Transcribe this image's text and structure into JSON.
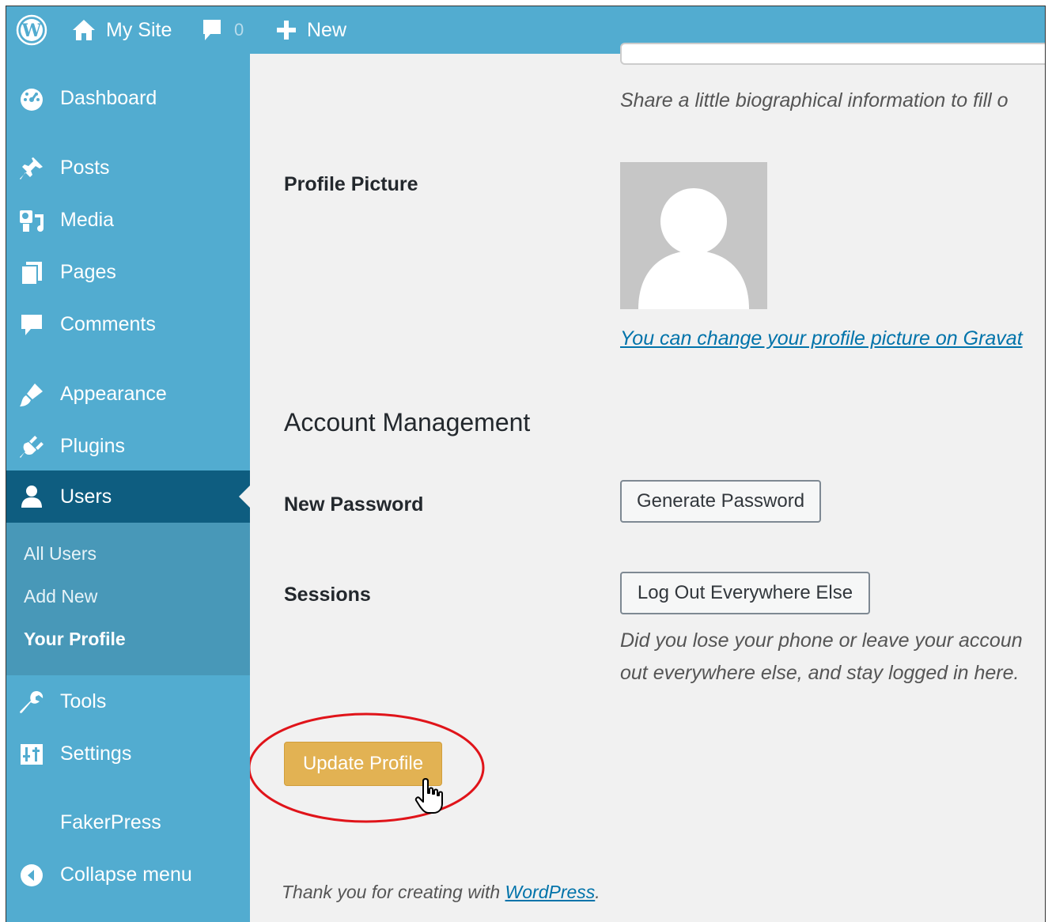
{
  "admin_bar": {
    "site_name": "My Site",
    "comment_count": "0",
    "new_label": "New"
  },
  "sidebar": {
    "items": [
      {
        "label": "Dashboard",
        "icon": "dashboard-icon"
      },
      {
        "label": "Posts",
        "icon": "pin-icon"
      },
      {
        "label": "Media",
        "icon": "media-icon"
      },
      {
        "label": "Pages",
        "icon": "pages-icon"
      },
      {
        "label": "Comments",
        "icon": "comment-icon"
      },
      {
        "label": "Appearance",
        "icon": "brush-icon"
      },
      {
        "label": "Plugins",
        "icon": "plugin-icon"
      },
      {
        "label": "Users",
        "icon": "user-icon",
        "active": true
      },
      {
        "label": "Tools",
        "icon": "wrench-icon"
      },
      {
        "label": "Settings",
        "icon": "settings-icon"
      },
      {
        "label": "FakerPress",
        "icon": ""
      },
      {
        "label": "Collapse menu",
        "icon": "collapse-icon"
      }
    ],
    "submenu": [
      {
        "label": "All Users"
      },
      {
        "label": "Add New"
      },
      {
        "label": "Your Profile",
        "current": true
      }
    ]
  },
  "profile": {
    "bio_description": "Share a little biographical information to fill o",
    "profile_picture_label": "Profile Picture",
    "gravatar_link": "You can change your profile picture on Gravat"
  },
  "account_management": {
    "heading": "Account Management",
    "new_password_label": "New Password",
    "generate_password_button": "Generate Password",
    "sessions_label": "Sessions",
    "logout_button": "Log Out Everywhere Else",
    "sessions_description_line1": "Did you lose your phone or leave your accoun",
    "sessions_description_line2": "out everywhere else, and stay logged in here."
  },
  "update_button": "Update Profile",
  "footer": {
    "text": "Thank you for creating with ",
    "link": "WordPress",
    "suffix": "."
  },
  "colors": {
    "admin_bar": "#52acd0",
    "sidebar": "#52acd0",
    "sidebar_active": "#0e5d80",
    "primary_button": "#e2b253",
    "annotation_circle": "#e0141a"
  }
}
